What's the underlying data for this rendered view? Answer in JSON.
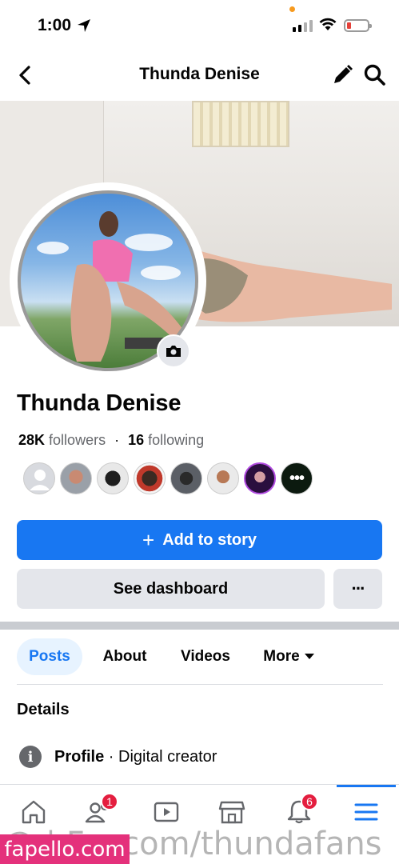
{
  "status_bar": {
    "time": "1:00"
  },
  "header": {
    "title": "Thunda Denise"
  },
  "profile": {
    "name": "Thunda Denise",
    "followers_count": "28K",
    "followers_label": "followers",
    "separator": "·",
    "following_count": "16",
    "following_label": "following"
  },
  "actions": {
    "add_story_label": "Add to story",
    "add_story_icon": "+",
    "see_dashboard_label": "See dashboard",
    "more_label": "···"
  },
  "tabs": [
    {
      "label": "Posts",
      "active": true
    },
    {
      "label": "About",
      "active": false
    },
    {
      "label": "Videos",
      "active": false
    },
    {
      "label": "More",
      "active": false
    }
  ],
  "details": {
    "title": "Details",
    "icon_glyph": "i",
    "profile_label": "Profile",
    "profile_value": " · Digital creator"
  },
  "bottom_nav": {
    "items": [
      "home-icon",
      "friends-icon",
      "watch-icon",
      "marketplace-icon",
      "notifications-icon",
      "menu-icon"
    ],
    "friends_badge": "1",
    "notifications_badge": "6"
  },
  "watermark": {
    "text": "@ | F  s.com/thundafans",
    "badge": "fapello.com"
  },
  "colors": {
    "accent": "#1877f2",
    "badge": "#e41e3f",
    "button_gray": "#e4e6eb",
    "watermark_pink": "#e4317b"
  }
}
